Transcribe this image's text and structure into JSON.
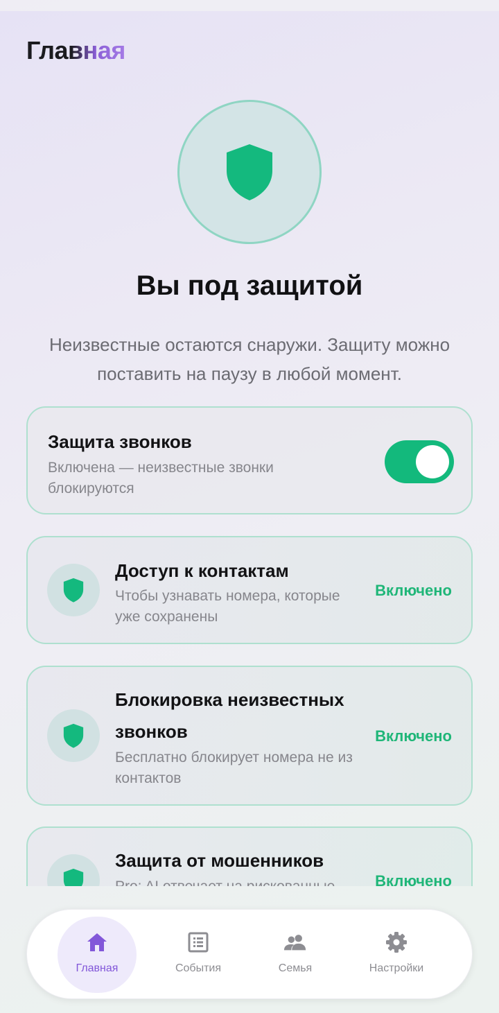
{
  "header": {
    "title": "Главная"
  },
  "hero": {
    "title": "Вы под защитой",
    "subtitle": "Неизвестные остаются снаружи. Защиту можно поставить на паузу в любой момент."
  },
  "call_protection": {
    "title": "Защита звонков",
    "description": "Включена — неизвестные звонки блокируются",
    "enabled": true
  },
  "features": [
    {
      "icon": "shield-icon",
      "title": "Доступ к контактам",
      "description": "Чтобы узнавать номера, которые уже сохранены",
      "status": "Включено"
    },
    {
      "icon": "shield-icon",
      "title": "Блокировка неизвестных звонков",
      "description": "Бесплатно блокирует номера не из контактов",
      "status": "Включено"
    },
    {
      "icon": "shield-icon",
      "title": "Защита от мошенников",
      "description": "Pro: AI отвечает на рискованные",
      "status": "Включено"
    }
  ],
  "nav": {
    "items": [
      {
        "icon": "home-icon",
        "label": "Главная",
        "active": true
      },
      {
        "icon": "list-icon",
        "label": "События",
        "active": false
      },
      {
        "icon": "group-icon",
        "label": "Семья",
        "active": false
      },
      {
        "icon": "gear-icon",
        "label": "Настройки",
        "active": false
      }
    ]
  },
  "colors": {
    "accent_green": "#13b97c",
    "status_green": "#1fb678",
    "accent_purple": "#8257d9",
    "card_border": "#aee0cf"
  }
}
